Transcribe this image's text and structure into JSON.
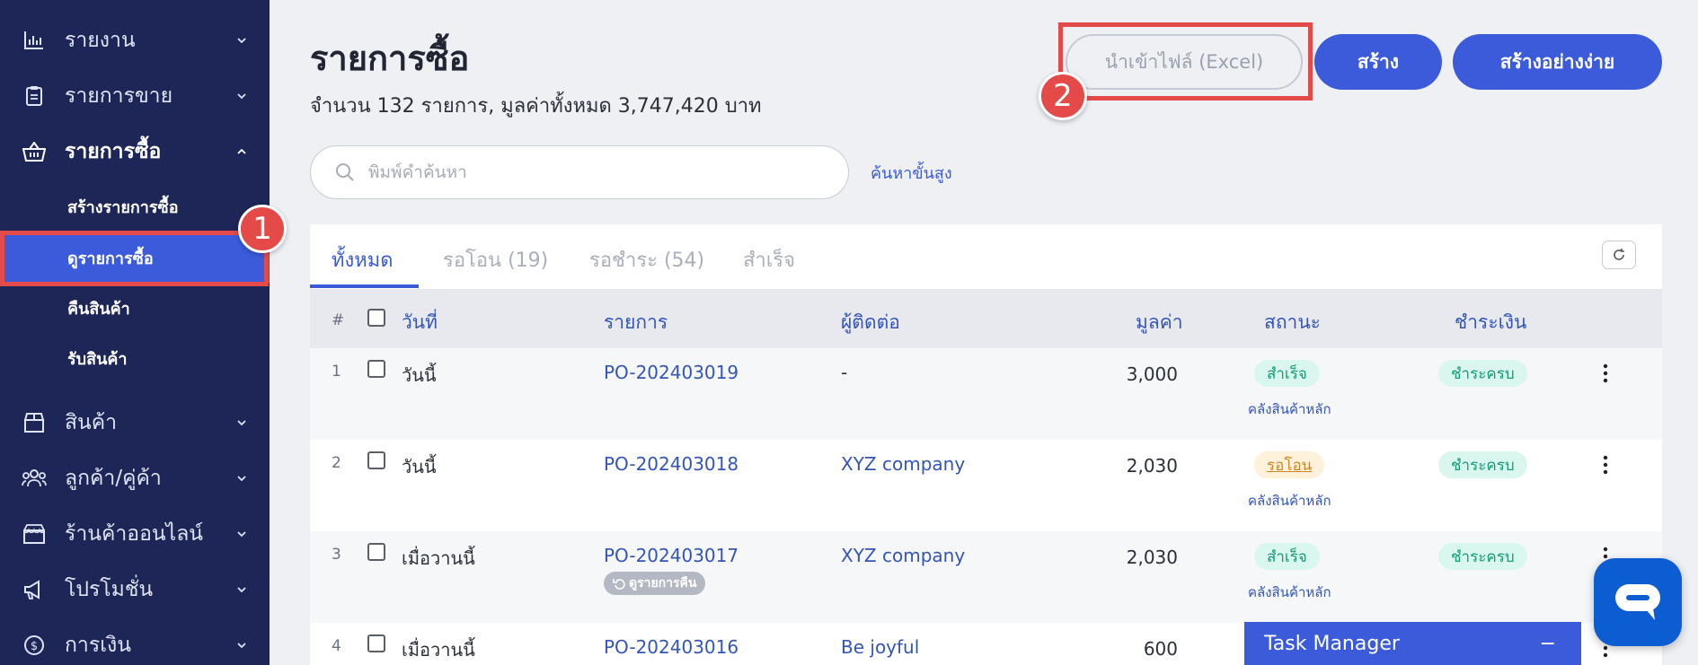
{
  "sidebar": {
    "items": [
      {
        "label": "รายงาน",
        "icon": "chart-icon"
      },
      {
        "label": "รายการขาย",
        "icon": "clipboard-icon"
      },
      {
        "label": "รายการซื้อ",
        "icon": "basket-icon"
      },
      {
        "label": "สินค้า",
        "icon": "box-icon"
      },
      {
        "label": "ลูกค้า/คู่ค้า",
        "icon": "users-icon"
      },
      {
        "label": "ร้านค้าออนไลน์",
        "icon": "store-icon"
      },
      {
        "label": "โปรโมชั่น",
        "icon": "megaphone-icon"
      },
      {
        "label": "การเงิน",
        "icon": "dollar-icon"
      }
    ],
    "sub_items": [
      {
        "label": "สร้างรายการซื้อ"
      },
      {
        "label": "ดูรายการซื้อ"
      },
      {
        "label": "คืนสินค้า"
      },
      {
        "label": "รับสินค้า"
      }
    ]
  },
  "annotations": {
    "step1": "1",
    "step2": "2"
  },
  "header": {
    "title": "รายการซื้อ",
    "subtitle": "จำนวน 132 รายการ, มูลค่าทั้งหมด 3,747,420 บาท",
    "import_label": "นำเข้าไฟล์ (Excel)",
    "create_label": "สร้าง",
    "create_simple_label": "สร้างอย่างง่าย"
  },
  "search": {
    "placeholder": "พิมพ์คำค้นหา",
    "advanced_label": "ค้นหาขั้นสูง"
  },
  "tabs": [
    {
      "label": "ทั้งหมด"
    },
    {
      "label": "รอโอน (19)"
    },
    {
      "label": "รอชำระ (54)"
    },
    {
      "label": "สำเร็จ"
    }
  ],
  "table": {
    "headers": {
      "hash": "#",
      "date": "วันที่",
      "item": "รายการ",
      "contact": "ผู้ติดต่อ",
      "value": "มูลค่า",
      "status": "สถานะ",
      "payment": "ชำระเงิน"
    },
    "rows": [
      {
        "num": "1",
        "date": "วันนี้",
        "item": "PO-202403019",
        "contact": "-",
        "value": "3,000",
        "status": "สำเร็จ",
        "warehouse": "คลังสินค้าหลัก",
        "payment": "ชำระครบ"
      },
      {
        "num": "2",
        "date": "วันนี้",
        "item": "PO-202403018",
        "contact": "XYZ company",
        "value": "2,030",
        "status": "รอโอน",
        "warehouse": "คลังสินค้าหลัก",
        "payment": "ชำระครบ"
      },
      {
        "num": "3",
        "date": "เมื่อวานนี้",
        "item": "PO-202403017",
        "return_chip": "ดูรายการคืน",
        "contact": "XYZ company",
        "value": "2,030",
        "status": "สำเร็จ",
        "warehouse": "คลังสินค้าหลัก",
        "payment": "ชำระครบ"
      },
      {
        "num": "4",
        "date": "เมื่อวานนี้",
        "item": "PO-202403016",
        "contact": "Be joyful",
        "value": "600"
      }
    ]
  },
  "task_manager": {
    "title": "Task Manager",
    "minimize": "−"
  },
  "colors": {
    "sidebar": "#1d2657",
    "accent": "#3b5bdb",
    "highlight": "#e44a47"
  }
}
